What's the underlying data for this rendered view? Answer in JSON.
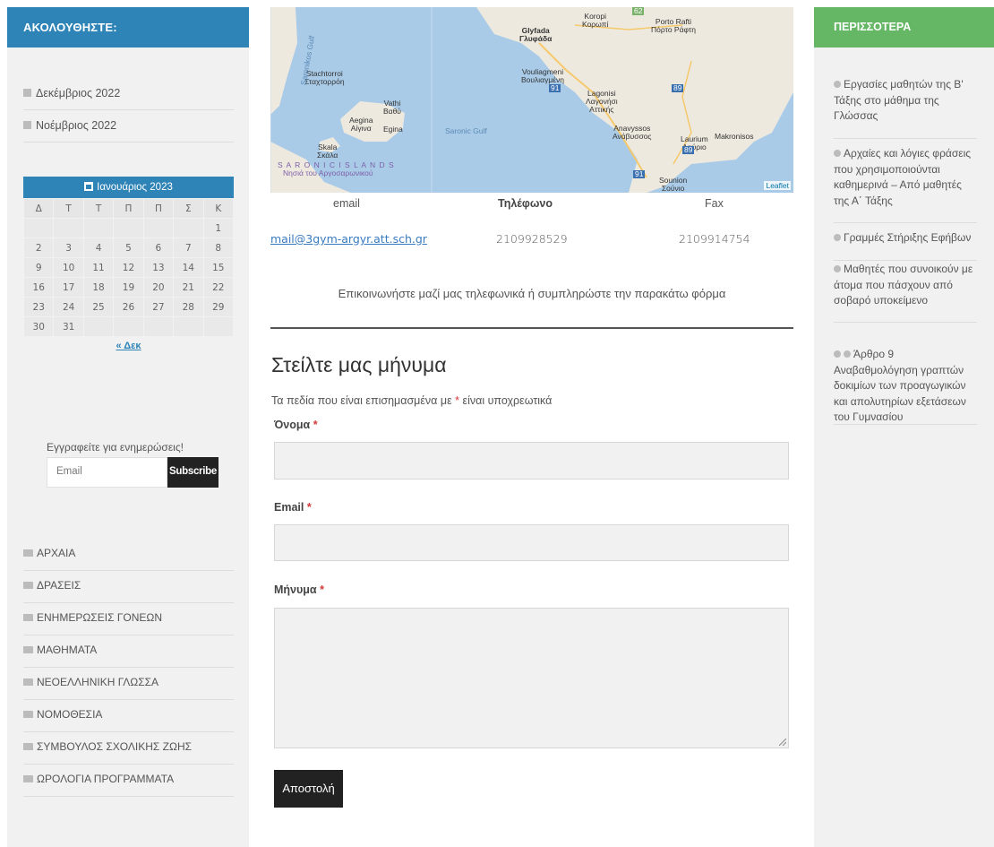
{
  "left_sidebar": {
    "follow_title": "ΑΚΟΛΟΥΘΗΣΤΕ:",
    "archives": [
      "Δεκέμβριος 2022",
      "Νοέμβριος 2022"
    ],
    "calendar": {
      "caption": "Ιανουάριος 2023",
      "weekdays": [
        "Δ",
        "Τ",
        "Τ",
        "Π",
        "Π",
        "Σ",
        "Κ"
      ],
      "weeks": [
        [
          "",
          "",
          "",
          "",
          "",
          "",
          "1"
        ],
        [
          "2",
          "3",
          "4",
          "5",
          "6",
          "7",
          "8"
        ],
        [
          "9",
          "10",
          "11",
          "12",
          "13",
          "14",
          "15"
        ],
        [
          "16",
          "17",
          "18",
          "19",
          "20",
          "21",
          "22"
        ],
        [
          "23",
          "24",
          "25",
          "26",
          "27",
          "28",
          "29"
        ],
        [
          "30",
          "31",
          "",
          "",
          "",
          "",
          ""
        ]
      ],
      "prev_link": "« Δεκ"
    },
    "subscribe": {
      "label": "Εγγραφείτε για ενημερώσεις!",
      "placeholder": "Email",
      "button": "Subscribe"
    },
    "categories": [
      "ΑΡΧΑΙΑ",
      "ΔΡΑΣΕΙΣ",
      "ΕΝΗΜΕΡΩΣΕΙΣ ΓΟΝΕΩΝ",
      "ΜΑΘΗΜΑΤΑ",
      "ΝΕΟΕΛΛΗΝΙΚΗ ΓΛΩΣΣΑ",
      "ΝΟΜΟΘΕΣΙΑ",
      "ΣΥΜΒΟΥΛΟΣ ΣΧΟΛΙΚΗΣ ΖΩΗΣ",
      "ΩΡΟΛΟΓΙΑ ΠΡΟΓΡΑΜΜΑΤΑ"
    ]
  },
  "map": {
    "labels": {
      "koropi": "Koropi\nΚορωπί",
      "porto_rafti": "Porto Rafti\nΠόρτο Ράφτη",
      "glyfada": "Glyfada\nΓλυφάδα",
      "stachtoroi": "Stachtorroi\nΣταχτορρόη",
      "vouliagmeni": "Vouliagmeni\nΒουλιαγμένη",
      "lagonisi": "Lagonisi\nΛαγονήσι\nΑττικής",
      "vathi": "Vathi\nΒαθύ",
      "aegina": "Aegina\nΑίγινα",
      "egina": "Egina",
      "saronic_gulf": "Saronic Gulf",
      "anavyssos": "Anavyssos\nΑνάβυσσος",
      "laurium": "Laurium\nΛαύριο",
      "makronisos": "Makronisos",
      "skala": "Skala\nΣκάλα",
      "saronic_islands": "S A R O N I C   I S L A N D S",
      "nisia": "Νησιά του Αργοσαρωνικού",
      "sounion": "Sounion\nΣούνιο",
      "road_62": "62",
      "road_91a": "91",
      "road_89a": "89",
      "road_89b": "89",
      "road_91b": "91",
      "saronikos": "Saronikos Gulf"
    },
    "attribution": "Leaflet"
  },
  "contact": {
    "headers": {
      "email": "email",
      "phone": "Τηλέφωνο",
      "fax": "Fax"
    },
    "values": {
      "email": "mail@3gym-argyr.att.sch.gr",
      "phone": "2109928529",
      "fax": "2109914754"
    },
    "intro": "Επικοινωνήστε μαζί μας τηλεφωνικά ή συμπληρώστε την παρακάτω φόρμα"
  },
  "form": {
    "title": "Στείλτε μας μήνυμα",
    "required_note_before": "Τα πεδία που είναι επισημασμένα με",
    "required_note_after": "είναι υποχρεωτικά",
    "star": "*",
    "name_label": "Όνομα",
    "email_label": "Email",
    "message_label": "Μήνυμα",
    "submit": "Αποστολή"
  },
  "right_sidebar": {
    "title": "ΠΕΡΙΣΣΟΤΕΡΑ",
    "items": [
      "Εργασίες μαθητών της Β' Τάξης στο μάθημα της Γλώσσας",
      "Αρχαίες και λόγιες φράσεις που χρησιμοποιούνται καθημερινά – Από μαθητές της Α΄ Τάξης",
      "Γραμμές Στήριξης Εφήβων",
      "Μαθητές που συνοικούν με άτομα που πάσχουν από σοβαρό υποκείμενο",
      "Άρθρο 9 Αναβαθμολόγηση γραπτών δοκιμίων των προαγωγικών και απολυτηρίων εξετάσεων του Γυμνασίου"
    ]
  },
  "colors": {
    "follow_header": "#2e83b7",
    "more_header": "#65b765",
    "button": "#222222",
    "sea": "#a9cbe8",
    "land": "#eee9df"
  }
}
